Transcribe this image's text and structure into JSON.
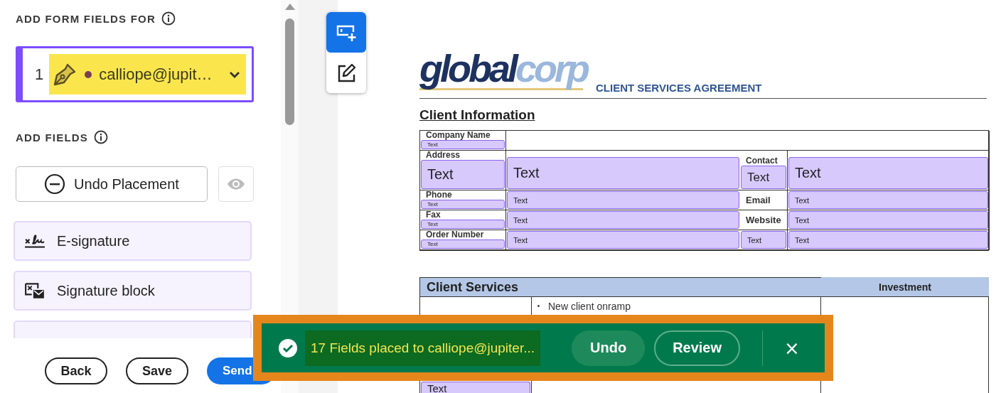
{
  "sidebar": {
    "recipient_heading": "ADD FORM FIELDS FOR",
    "recipient": {
      "index": "1",
      "email": "calliope@jupit…",
      "color": "#7b3f55",
      "highlighted": true
    },
    "fields_heading": "ADD FIELDS",
    "undo_button": "Undo Placement",
    "field_options": [
      {
        "label": "E-signature",
        "kind": "esignature"
      },
      {
        "label": "Signature block",
        "kind": "signature_block"
      }
    ],
    "footer_buttons": [
      {
        "label": "Back",
        "kind": "outline"
      },
      {
        "label": "Save",
        "kind": "outline"
      },
      {
        "label": "Send",
        "kind": "primary"
      }
    ]
  },
  "toolbar": [
    {
      "kind": "add_field",
      "selected": true
    },
    {
      "kind": "edit",
      "selected": false
    }
  ],
  "document": {
    "logo": {
      "primary": "global",
      "secondary": "corp"
    },
    "title": "CLIENT SERVICES AGREEMENT",
    "section_title": "Client Information",
    "info_table": [
      [
        {
          "kind": "label",
          "text": "Company Name",
          "field": "Text"
        },
        {
          "kind": "empty"
        }
      ],
      [
        {
          "kind": "label",
          "text": "Address",
          "field": "Text"
        },
        {
          "kind": "field",
          "field": "Text"
        },
        {
          "kind": "label",
          "text": "Contact",
          "field": "Text"
        },
        {
          "kind": "field",
          "field": "Text"
        }
      ],
      [
        {
          "kind": "label",
          "text": "Phone",
          "field": "Text"
        },
        {
          "kind": "field",
          "field": "Text"
        },
        {
          "kind": "label",
          "text": "Email"
        },
        {
          "kind": "field",
          "field": "Text"
        }
      ],
      [
        {
          "kind": "label",
          "text": "Fax",
          "field": "Text"
        },
        {
          "kind": "field",
          "field": "Text"
        },
        {
          "kind": "label",
          "text": "Website"
        },
        {
          "kind": "field",
          "field": "Text"
        }
      ],
      [
        {
          "kind": "label",
          "text": "Order Number",
          "field": "Text"
        },
        {
          "kind": "field",
          "field": "Text"
        },
        {
          "kind": "field",
          "field": "Text"
        },
        {
          "kind": "field",
          "field": "Text"
        }
      ]
    ],
    "services_table": {
      "headers": [
        "Client Services",
        "Investment"
      ],
      "field": "Text",
      "bullets": [
        "New client onramp"
      ]
    }
  },
  "toast": {
    "message": "17 Fields placed to calliope@jupiter...",
    "highlighted": true,
    "buttons": [
      {
        "label": "Undo",
        "kind": "filled"
      },
      {
        "label": "Review",
        "kind": "outline"
      }
    ],
    "close": "×"
  }
}
